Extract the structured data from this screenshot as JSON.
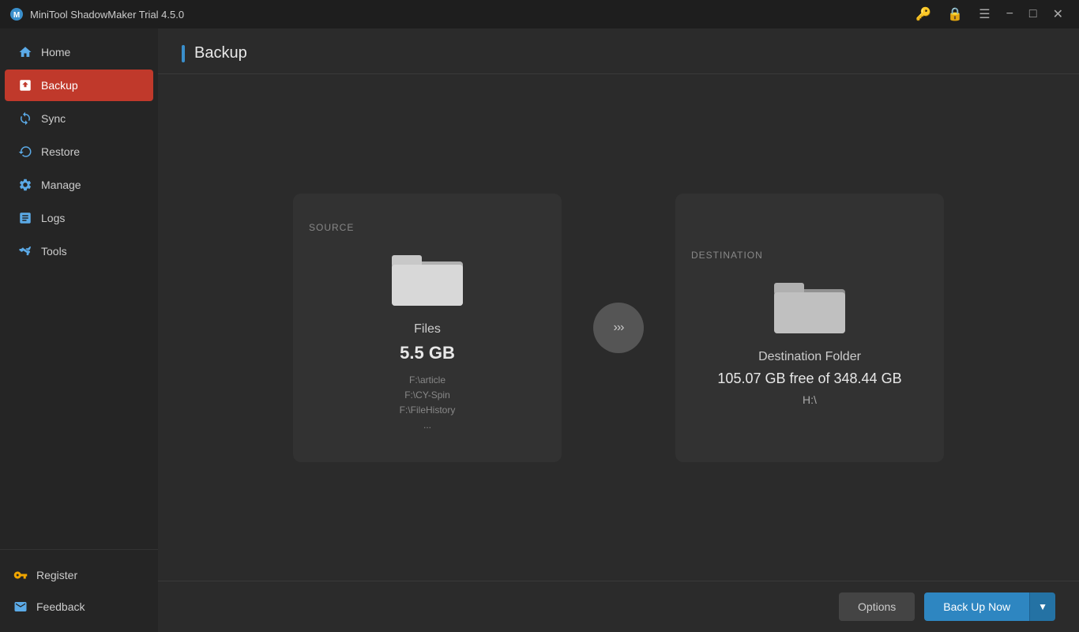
{
  "titlebar": {
    "app_name": "MiniTool ShadowMaker Trial 4.5.0",
    "icons": {
      "key": "🔑",
      "lock": "🔒",
      "menu": "☰",
      "minimize": "−",
      "maximize": "□",
      "close": "✕"
    }
  },
  "sidebar": {
    "nav_items": [
      {
        "id": "home",
        "label": "Home",
        "icon": "🏠",
        "active": false
      },
      {
        "id": "backup",
        "label": "Backup",
        "icon": "📋",
        "active": true
      },
      {
        "id": "sync",
        "label": "Sync",
        "icon": "🔄",
        "active": false
      },
      {
        "id": "restore",
        "label": "Restore",
        "icon": "↩",
        "active": false
      },
      {
        "id": "manage",
        "label": "Manage",
        "icon": "⚙",
        "active": false
      },
      {
        "id": "logs",
        "label": "Logs",
        "icon": "📄",
        "active": false
      },
      {
        "id": "tools",
        "label": "Tools",
        "icon": "🛠",
        "active": false
      }
    ],
    "bottom_items": [
      {
        "id": "register",
        "label": "Register",
        "icon": "🔑"
      },
      {
        "id": "feedback",
        "label": "Feedback",
        "icon": "✉"
      }
    ]
  },
  "page": {
    "title": "Backup"
  },
  "source_card": {
    "section_label": "SOURCE",
    "type_label": "Files",
    "size": "5.5 GB",
    "paths": [
      "F:\\article",
      "F:\\CY-Spin",
      "F:\\FileHistory",
      "..."
    ]
  },
  "destination_card": {
    "section_label": "DESTINATION",
    "type_label": "Destination Folder",
    "free_space": "105.07 GB free of 348.44 GB",
    "drive": "H:\\"
  },
  "arrow": {
    "symbol": "»»»"
  },
  "footer": {
    "options_label": "Options",
    "backup_now_label": "Back Up Now",
    "dropdown_symbol": "▼"
  }
}
